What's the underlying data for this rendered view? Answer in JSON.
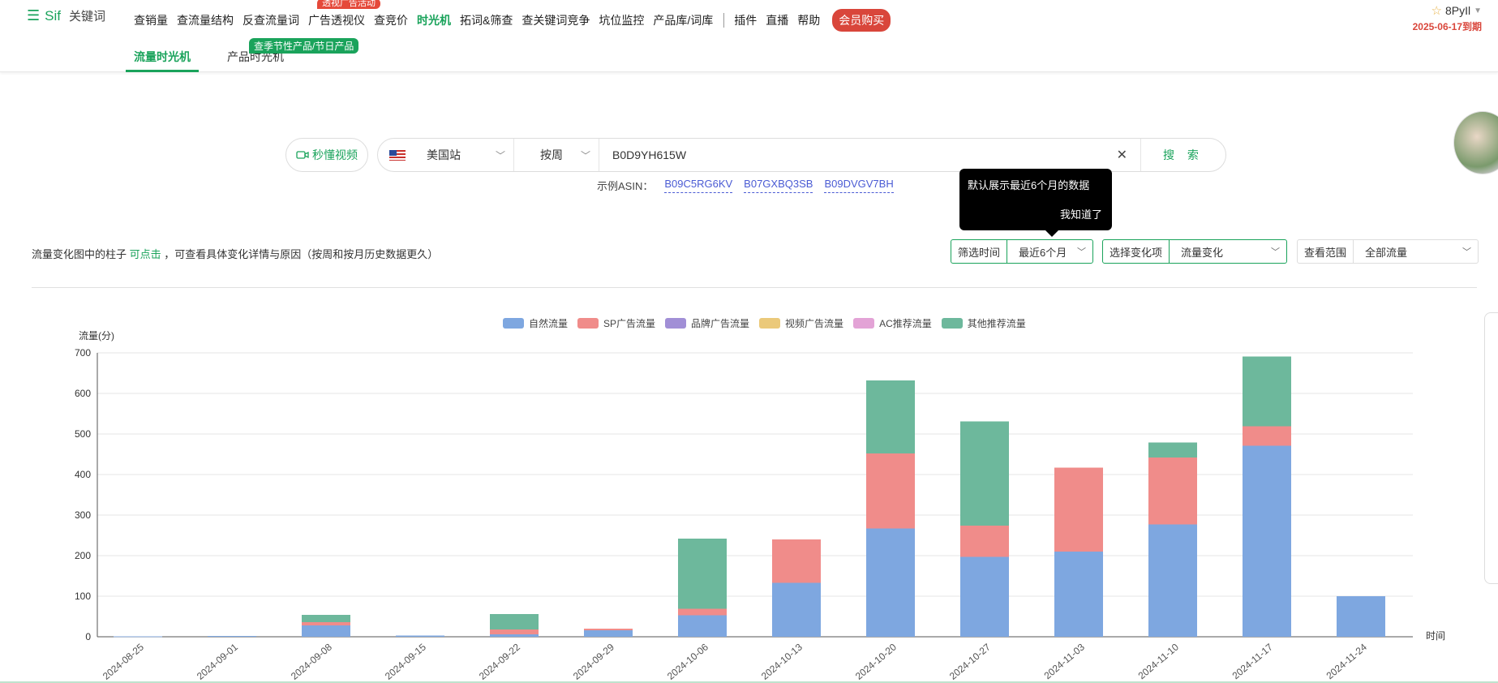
{
  "app": {
    "brand": "Sif",
    "brand_sub": "关键词"
  },
  "nav": {
    "items": [
      "查销量",
      "查流量结构",
      "反查流量词",
      "广告透视仪",
      "查竞价",
      "时光机",
      "拓词&筛查",
      "查关键词竞争",
      "坑位监控",
      "产品库/词库"
    ],
    "items2": [
      "插件",
      "直播",
      "帮助"
    ],
    "buy": "会员购买",
    "badge_ad": "透视广告活动"
  },
  "user": {
    "name": "8PyIl",
    "expire": "2025-06-17到期"
  },
  "subtabs": {
    "traffic": "流量时光机",
    "product": "产品时光机",
    "badge": "查季节性产品/节日产品"
  },
  "search": {
    "video": "秒懂视频",
    "site": "美国站",
    "period": "按周",
    "asin": "B0D9YH615W",
    "button": "搜 索"
  },
  "examples": {
    "label": "示例ASIN：",
    "asins": [
      "B09C5RG6KV",
      "B07GXBQ3SB",
      "B09DVGV7BH"
    ]
  },
  "tooltip": {
    "text": "默认展示最近6个月的数据",
    "ok": "我知道了"
  },
  "hint": {
    "prefix": "流量变化图中的柱子",
    "link": "可点击",
    "suffix": "，可查看具体变化详情与原因（按周和按月历史数据更久）"
  },
  "filters": {
    "time_label": "筛选时间",
    "time_value": "最近6个月",
    "change_label": "选择变化项",
    "change_value": "流量变化",
    "range_label": "查看范围",
    "range_value": "全部流量"
  },
  "colors": {
    "organic": "#7ea7e0",
    "sp": "#f08c8a",
    "brand": "#a18fd6",
    "video": "#ebc97a",
    "ac": "#e3a3d6",
    "other": "#6db89c",
    "accent": "#1aa35b"
  },
  "chart_data": {
    "type": "bar",
    "stacked": true,
    "ylabel": "流量(分)",
    "xlabel": "时间",
    "ylim": [
      0,
      700
    ],
    "yticks": [
      0,
      100,
      200,
      300,
      400,
      500,
      600,
      700
    ],
    "grid": true,
    "legend_position": "top-center",
    "categories": [
      "2024-08-25",
      "2024-09-01",
      "2024-09-08",
      "2024-09-15",
      "2024-09-22",
      "2024-09-29",
      "2024-10-06",
      "2024-10-13",
      "2024-10-20",
      "2024-10-27",
      "2024-11-03",
      "2024-11-10",
      "2024-11-17",
      "2024-11-24"
    ],
    "series": [
      {
        "name": "自然流量",
        "color_key": "organic",
        "values": [
          1,
          2,
          28,
          3,
          6,
          16,
          53,
          133,
          267,
          197,
          210,
          277,
          471,
          100
        ]
      },
      {
        "name": "SP广告流量",
        "color_key": "sp",
        "values": [
          0,
          0,
          8,
          0,
          12,
          4,
          16,
          107,
          185,
          77,
          207,
          165,
          48,
          0
        ]
      },
      {
        "name": "品牌广告流量",
        "color_key": "brand",
        "values": [
          0,
          0,
          0,
          0,
          0,
          0,
          0,
          0,
          0,
          0,
          0,
          0,
          0,
          0
        ]
      },
      {
        "name": "视频广告流量",
        "color_key": "video",
        "values": [
          0,
          0,
          0,
          0,
          0,
          0,
          0,
          0,
          0,
          0,
          0,
          0,
          0,
          0
        ]
      },
      {
        "name": "AC推荐流量",
        "color_key": "ac",
        "values": [
          0,
          0,
          0,
          0,
          0,
          0,
          0,
          0,
          0,
          0,
          0,
          0,
          0,
          0
        ]
      },
      {
        "name": "其他推荐流量",
        "color_key": "other",
        "values": [
          0,
          0,
          18,
          0,
          38,
          0,
          173,
          0,
          180,
          257,
          0,
          37,
          172,
          0
        ]
      }
    ]
  }
}
